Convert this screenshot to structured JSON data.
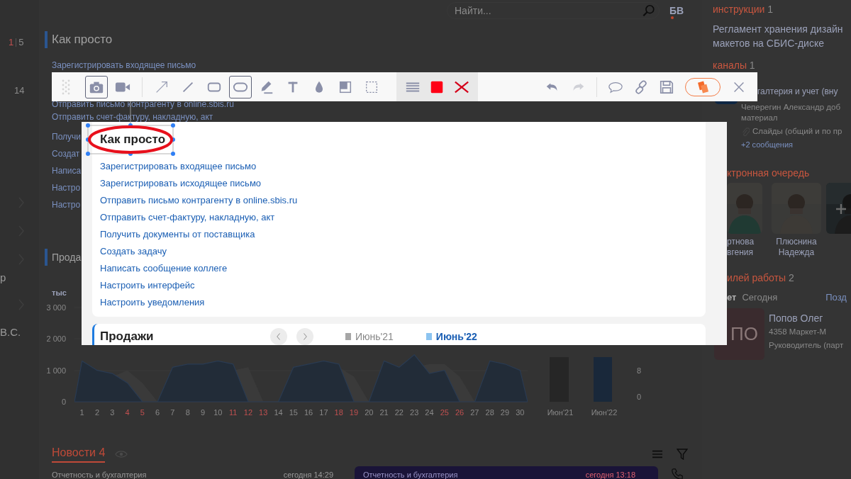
{
  "header": {
    "search": {
      "placeholder": "Найти..."
    },
    "user_initials": "БВ",
    "notification": true
  },
  "left_rail": {
    "unread": "1",
    "total": "5",
    "count": "14",
    "name_part": "р",
    "initials_part": "В.С."
  },
  "quick_links": {
    "title": "Как просто",
    "links": [
      "Зарегистрировать входящее письмо",
      "Отправить письмо контрагенту в online.sbis.ru",
      "Отправить счет-фактуру, накладную, акт",
      "Получи",
      "Создат",
      "Написа",
      "Настро",
      "Настро"
    ]
  },
  "sales": {
    "title": "Прода",
    "unit": "тыс",
    "y_ticks": [
      "3 000",
      "2 000",
      "1 000",
      "0"
    ],
    "days": [
      {
        "label": "1",
        "weekend": false
      },
      {
        "label": "2",
        "weekend": false
      },
      {
        "label": "3",
        "weekend": false
      },
      {
        "label": "4",
        "weekend": true
      },
      {
        "label": "5",
        "weekend": true
      },
      {
        "label": "6",
        "weekend": false
      },
      {
        "label": "7",
        "weekend": false
      },
      {
        "label": "8",
        "weekend": false
      },
      {
        "label": "9",
        "weekend": false
      },
      {
        "label": "10",
        "weekend": false
      },
      {
        "label": "11",
        "weekend": true
      },
      {
        "label": "12",
        "weekend": true
      },
      {
        "label": "13",
        "weekend": true
      },
      {
        "label": "14",
        "weekend": false
      },
      {
        "label": "15",
        "weekend": false
      },
      {
        "label": "16",
        "weekend": false
      },
      {
        "label": "17",
        "weekend": false
      },
      {
        "label": "18",
        "weekend": true
      },
      {
        "label": "19",
        "weekend": true
      },
      {
        "label": "20",
        "weekend": false
      },
      {
        "label": "21",
        "weekend": false
      },
      {
        "label": "22",
        "weekend": false
      },
      {
        "label": "23",
        "weekend": false
      },
      {
        "label": "24",
        "weekend": false
      },
      {
        "label": "25",
        "weekend": true
      },
      {
        "label": "26",
        "weekend": true
      },
      {
        "label": "27",
        "weekend": false
      },
      {
        "label": "28",
        "weekend": false
      },
      {
        "label": "29",
        "weekend": false
      },
      {
        "label": "30",
        "weekend": false
      }
    ],
    "compare_labels": [
      "Июн'21",
      "Июн'22"
    ],
    "right_ticks": [
      "8",
      "0"
    ]
  },
  "news": {
    "title": "Новости",
    "count": "4",
    "items": [
      {
        "category": "Отчетность и бухгалтерия",
        "time": "сегодня 14:29",
        "highlighted": false
      },
      {
        "category": "Отчетность и бухгалтерия",
        "time": "сегодня 13:18",
        "highlighted": true
      }
    ]
  },
  "sidebar": {
    "instructions": {
      "title": "инструкции",
      "count": "1",
      "item": "Регламент хранения дизайн макетов на СБИС-диске"
    },
    "channels": {
      "title": "каналы",
      "count": "1",
      "name": "галтерия и учет (вну",
      "author": "Чеперегин Александр доб",
      "author_rest": "материал",
      "attachment": "Слайды (общий и по пр",
      "more": "+2 сообщения"
    },
    "queue": {
      "title": "ктронная очередь",
      "people": [
        {
          "name": "ртнова вгения",
          "add": false
        },
        {
          "name": "Плюснина Надежда",
          "add": false
        },
        {
          "add": true
        }
      ]
    },
    "employees": {
      "title": "илей работы",
      "count": "2",
      "tabs": [
        {
          "label": "ет",
          "selected": true
        },
        {
          "label": "Сегодня",
          "selected": false
        }
      ],
      "link": "Позд",
      "person": {
        "initials": "ПО",
        "name": "Попов Олег",
        "company": "4358 Маркет-М",
        "role": "Руководитель (парт"
      }
    }
  },
  "toolbar": {
    "capture_modes": [
      {
        "kind": "camera",
        "selected": true
      },
      {
        "kind": "video",
        "selected": false
      }
    ],
    "draw_tools": [
      {
        "kind": "arrow",
        "selected": false
      },
      {
        "kind": "line",
        "selected": false
      },
      {
        "kind": "rectangle",
        "selected": false
      },
      {
        "kind": "ellipse",
        "selected": true
      },
      {
        "kind": "pencil",
        "selected": false
      },
      {
        "kind": "text",
        "selected": false
      },
      {
        "kind": "blur",
        "selected": false
      },
      {
        "kind": "fill",
        "selected": false
      },
      {
        "kind": "selection",
        "selected": false
      }
    ],
    "color": "#ff0016",
    "actions": [
      {
        "kind": "undo",
        "disabled": false
      },
      {
        "kind": "redo",
        "disabled": true
      },
      {
        "kind": "comment",
        "disabled": false
      },
      {
        "kind": "link",
        "disabled": false
      },
      {
        "kind": "save",
        "disabled": false
      },
      {
        "kind": "share",
        "disabled": false
      },
      {
        "kind": "close",
        "disabled": false
      }
    ]
  },
  "capture": {
    "card": {
      "title": "Как просто",
      "links": [
        "Зарегистрировать входящее письмо",
        "Зарегистрировать исходящее письмо",
        "Отправить письмо контрагенту в online.sbis.ru",
        "Отправить счет-фактуру, накладную, акт",
        "Получить документы от поставщика",
        "Создать задачу",
        "Написать сообщение коллеге",
        "Настроить интерфейс",
        "Настроить уведомления"
      ]
    },
    "sales_card": {
      "title": "Продажи",
      "legend": [
        {
          "label": "Июнь'21",
          "color": "#a6a6a6",
          "selected": false
        },
        {
          "label": "Июнь'22",
          "color": "#8cc4f0",
          "selected": true
        }
      ]
    },
    "annotation": {
      "kind": "ellipse",
      "color": "#e8101c",
      "selected": true
    }
  }
}
